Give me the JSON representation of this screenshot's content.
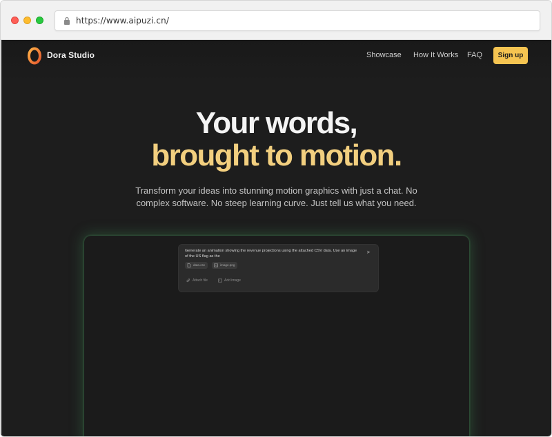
{
  "browser": {
    "url": "https://www.aipuzi.cn/"
  },
  "nav": {
    "brand": "Dora Studio",
    "links": [
      "Showcase",
      "How It Works",
      "FAQ"
    ],
    "signup_label": "Sign up"
  },
  "hero": {
    "line1": "Your words,",
    "line2": "brought to motion.",
    "subtitle": "Transform your ideas into stunning motion graphics with just a chat. No complex software. No steep learning curve. Just tell us what you need."
  },
  "demo": {
    "prompt": "Generate an animation showing the revenue projections using the attached CSV data. Use an image of the US flag as the",
    "attachments": [
      "data.csv",
      "image.png"
    ],
    "actions": [
      "Attach file",
      "Add image"
    ]
  },
  "colors": {
    "background": "#1d1d1d",
    "accent": "#f5c451",
    "hero_gold": "#f2cf7f",
    "panel_glow": "#3c8250"
  },
  "icons": {
    "lock": "lock-icon",
    "logo": "dora-logo-icon",
    "send": "send-icon",
    "file": "file-icon",
    "image": "image-icon",
    "paperclip": "paperclip-icon"
  }
}
